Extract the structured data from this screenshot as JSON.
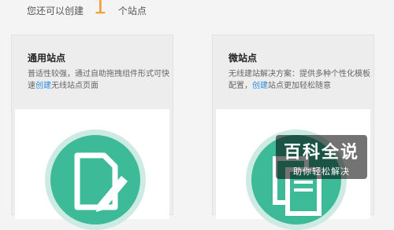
{
  "header": {
    "prefix": "您还可以创建",
    "count": "1",
    "suffix": "个站点"
  },
  "cards": [
    {
      "title": "通用站点",
      "desc_before": "普适性较强，通过自助拖拽组件形式可快速",
      "desc_link": "创建",
      "desc_after": "无线站点页面",
      "icon": "document-pencil-icon"
    },
    {
      "title": "微站点",
      "desc_before": "无线建站解决方案：提供多种个性化模板配置，",
      "desc_link": "创建",
      "desc_after": "站点更加轻松随意",
      "icon": "template-pages-icon"
    }
  ],
  "watermark": {
    "title": "百科全说",
    "subtitle": "助你轻松解决"
  },
  "colors": {
    "accent_number": "#f0a040",
    "link": "#2a8be0",
    "icon_green": "#3dbb99",
    "icon_ring": "#cdebe2"
  }
}
